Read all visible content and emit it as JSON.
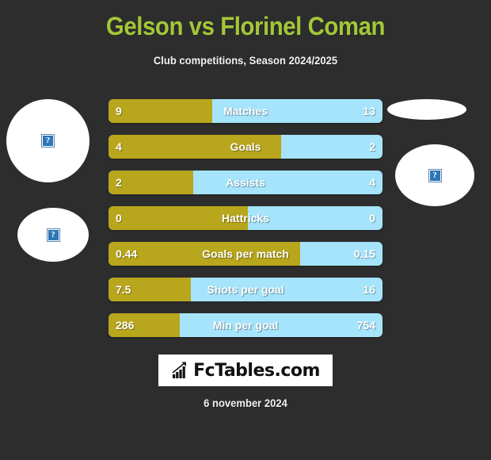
{
  "header": {
    "title": "Gelson vs Florinel Coman",
    "subtitle": "Club competitions, Season 2024/2025",
    "title_color": "#a4c639"
  },
  "colors": {
    "background": "#2d2d2d",
    "home_bar": "#b8a61c",
    "away_bar": "#a5e4fb",
    "title_green": "#a4c639",
    "text_white": "#ffffff"
  },
  "avatars": [
    {
      "name": "home-player-photo-top",
      "placeholder": "?"
    },
    {
      "name": "home-player-photo-bottom",
      "placeholder": "?"
    },
    {
      "name": "away-player-photo-top",
      "placeholder": ""
    },
    {
      "name": "away-player-photo-bottom",
      "placeholder": "?"
    }
  ],
  "chart_data": {
    "type": "bar",
    "title": "Gelson vs Florinel Coman",
    "subtitle": "Club competitions, Season 2024/2025",
    "orientation": "horizontal-diverging",
    "series": [
      {
        "name": "Gelson",
        "side": "left",
        "color": "#b8a61c"
      },
      {
        "name": "Florinel Coman",
        "side": "right",
        "color": "#a5e4fb"
      }
    ],
    "categories": [
      "Matches",
      "Goals",
      "Assists",
      "Hattricks",
      "Goals per match",
      "Shots per goal",
      "Min per goal"
    ],
    "rows": [
      {
        "label": "Matches",
        "left": "9",
        "right": "13",
        "left_pct": 38
      },
      {
        "label": "Goals",
        "left": "4",
        "right": "2",
        "left_pct": 63
      },
      {
        "label": "Assists",
        "left": "2",
        "right": "4",
        "left_pct": 31
      },
      {
        "label": "Hattricks",
        "left": "0",
        "right": "0",
        "left_pct": 51
      },
      {
        "label": "Goals per match",
        "left": "0.44",
        "right": "0.15",
        "left_pct": 70
      },
      {
        "label": "Shots per goal",
        "left": "7.5",
        "right": "16",
        "left_pct": 30
      },
      {
        "label": "Min per goal",
        "left": "286",
        "right": "754",
        "left_pct": 26
      }
    ]
  },
  "logo": {
    "text": "FcTables.com",
    "icon": "bar-chart-growth-icon"
  },
  "footer": {
    "date": "6 november 2024"
  }
}
